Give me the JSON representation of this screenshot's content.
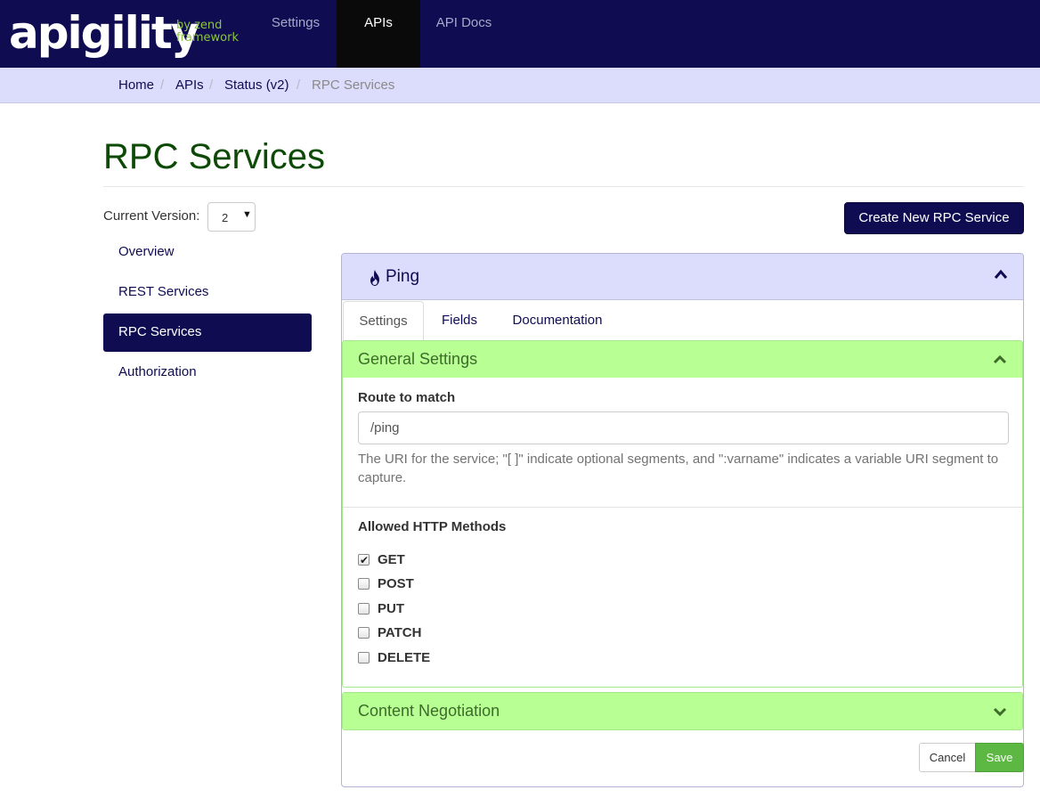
{
  "brand": {
    "logo_main": "apigility",
    "logo_sub_line1": "by zend",
    "logo_sub_line2": "framework"
  },
  "navbar": {
    "items": [
      {
        "label": "Settings",
        "active": false
      },
      {
        "label": "APIs",
        "active": true
      },
      {
        "label": "API Docs",
        "active": false
      }
    ]
  },
  "breadcrumb": {
    "items": [
      "Home",
      "APIs",
      "Status (v2)",
      "RPC Services"
    ],
    "separator": "/"
  },
  "page": {
    "title": "RPC Services"
  },
  "version": {
    "label": "Current Version:",
    "selected": "2"
  },
  "sidebar": {
    "items": [
      {
        "label": "Overview",
        "active": false
      },
      {
        "label": "REST Services",
        "active": false
      },
      {
        "label": "RPC Services",
        "active": true
      },
      {
        "label": "Authorization",
        "active": false
      }
    ]
  },
  "actions": {
    "create_label": "Create New RPC Service"
  },
  "service": {
    "name": "Ping",
    "icon": "flame-icon",
    "tabs": [
      {
        "label": "Settings",
        "active": true
      },
      {
        "label": "Fields",
        "active": false
      },
      {
        "label": "Documentation",
        "active": false
      }
    ]
  },
  "general_settings": {
    "title": "General Settings",
    "expanded": true,
    "route_label": "Route to match",
    "route_value": "/ping",
    "route_help": "The URI for the service; \"[ ]\" indicate optional segments, and \":varname\" indicates a variable URI segment to capture.",
    "methods_label": "Allowed HTTP Methods",
    "methods": [
      {
        "label": "GET",
        "checked": true
      },
      {
        "label": "POST",
        "checked": false
      },
      {
        "label": "PUT",
        "checked": false
      },
      {
        "label": "PATCH",
        "checked": false
      },
      {
        "label": "DELETE",
        "checked": false
      }
    ]
  },
  "content_negotiation": {
    "title": "Content Negotiation",
    "expanded": false
  },
  "footer": {
    "cancel_label": "Cancel",
    "save_label": "Save"
  },
  "colors": {
    "navbar": "#0f0c52",
    "breadcrumb_bg": "#dcdcfc",
    "title": "#0c4a06",
    "section_header": "#b8ff94",
    "save": "#5cb843",
    "logo_accent": "#8cc63f"
  }
}
